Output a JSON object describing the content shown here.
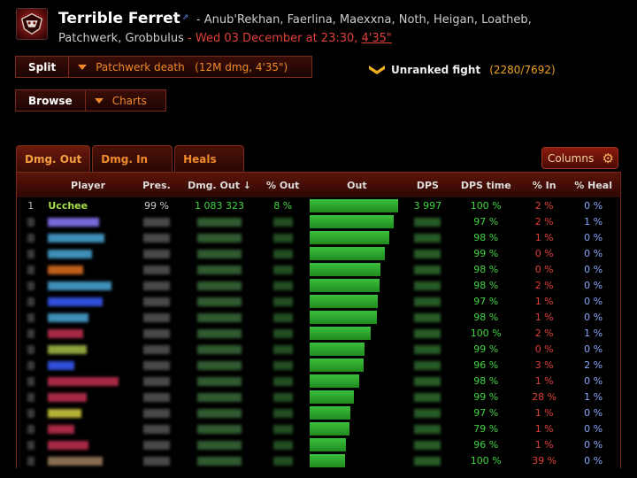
{
  "header": {
    "guild_name": "Terrible Ferret",
    "separator": " - ",
    "bosses_line1": "Anub'Rekhan, Faerlina, Maexxna, Noth, Heigan, Loatheb,",
    "bosses_line2": "Patchwerk, Grobbulus",
    "date": "Wed 03 December at 23:30,",
    "duration": "4'35\""
  },
  "toolbar": {
    "split_label": "Split",
    "split_dropdown": "Patchwerk death   (12M dmg, 4'35\")",
    "browse_label": "Browse",
    "charts_label": "Charts"
  },
  "ranking": {
    "label": "Unranked fight",
    "count": "(2280/7692)"
  },
  "tabs": [
    "Dmg. Out",
    "Dmg. In",
    "Heals"
  ],
  "columns_label": "Columns",
  "table": {
    "headers": [
      "Player",
      "Pres.",
      "Dmg. Out ↓",
      "% Out",
      "Out",
      "DPS",
      "DPS time",
      "% In",
      "% Heal"
    ],
    "rows": [
      {
        "idx": "1",
        "name": "Ucchee",
        "pres": "99 %",
        "dmg": "1 083 323",
        "pout": "8 %",
        "out": 1.0,
        "dps": "3 997",
        "time": "100 %",
        "pin": "2 %",
        "pheal": "0 %"
      },
      {
        "idx": "",
        "name": "",
        "pres": "",
        "dmg": "",
        "pout": "",
        "out": 0.95,
        "dps": "",
        "time": "97 %",
        "pin": "2 %",
        "pheal": "1 %"
      },
      {
        "idx": "",
        "name": "",
        "pres": "",
        "dmg": "",
        "pout": "",
        "out": 0.9,
        "dps": "",
        "time": "98 %",
        "pin": "1 %",
        "pheal": "0 %"
      },
      {
        "idx": "",
        "name": "",
        "pres": "",
        "dmg": "",
        "pout": "",
        "out": 0.85,
        "dps": "",
        "time": "99 %",
        "pin": "0 %",
        "pheal": "0 %"
      },
      {
        "idx": "",
        "name": "",
        "pres": "",
        "dmg": "",
        "pout": "",
        "out": 0.8,
        "dps": "",
        "time": "98 %",
        "pin": "0 %",
        "pheal": "0 %"
      },
      {
        "idx": "",
        "name": "",
        "pres": "",
        "dmg": "",
        "pout": "",
        "out": 0.79,
        "dps": "",
        "time": "98 %",
        "pin": "2 %",
        "pheal": "0 %"
      },
      {
        "idx": "",
        "name": "",
        "pres": "",
        "dmg": "",
        "pout": "",
        "out": 0.77,
        "dps": "",
        "time": "97 %",
        "pin": "1 %",
        "pheal": "0 %"
      },
      {
        "idx": "",
        "name": "",
        "pres": "",
        "dmg": "",
        "pout": "",
        "out": 0.76,
        "dps": "",
        "time": "98 %",
        "pin": "1 %",
        "pheal": "0 %"
      },
      {
        "idx": "",
        "name": "",
        "pres": "",
        "dmg": "",
        "pout": "",
        "out": 0.69,
        "dps": "",
        "time": "100 %",
        "pin": "2 %",
        "pheal": "1 %"
      },
      {
        "idx": "",
        "name": "",
        "pres": "",
        "dmg": "",
        "pout": "",
        "out": 0.62,
        "dps": "",
        "time": "99 %",
        "pin": "0 %",
        "pheal": "0 %"
      },
      {
        "idx": "",
        "name": "",
        "pres": "",
        "dmg": "",
        "pout": "",
        "out": 0.61,
        "dps": "",
        "time": "96 %",
        "pin": "3 %",
        "pheal": "2 %"
      },
      {
        "idx": "",
        "name": "",
        "pres": "",
        "dmg": "",
        "pout": "",
        "out": 0.56,
        "dps": "",
        "time": "98 %",
        "pin": "1 %",
        "pheal": "0 %"
      },
      {
        "idx": "",
        "name": "",
        "pres": "",
        "dmg": "",
        "pout": "",
        "out": 0.5,
        "dps": "",
        "time": "99 %",
        "pin": "28 %",
        "pheal": "1 %"
      },
      {
        "idx": "",
        "name": "",
        "pres": "",
        "dmg": "",
        "pout": "",
        "out": 0.46,
        "dps": "",
        "time": "97 %",
        "pin": "1 %",
        "pheal": "0 %"
      },
      {
        "idx": "",
        "name": "",
        "pres": "",
        "dmg": "",
        "pout": "",
        "out": 0.45,
        "dps": "",
        "time": "79 %",
        "pin": "1 %",
        "pheal": "0 %"
      },
      {
        "idx": "",
        "name": "",
        "pres": "",
        "dmg": "",
        "pout": "",
        "out": 0.41,
        "dps": "",
        "time": "96 %",
        "pin": "1 %",
        "pheal": "0 %"
      },
      {
        "idx": "",
        "name": "",
        "pres": "",
        "dmg": "",
        "pout": "",
        "out": 0.4,
        "dps": "",
        "time": "100 %",
        "pin": "39 %",
        "pheal": "0 %"
      }
    ],
    "name_colors": [
      "#a6e04a",
      "#8c7cff",
      "#4aa8d8",
      "#4aa8d8",
      "#e07020",
      "#4aa8d8",
      "#3a5cff",
      "#4aa8d8",
      "#c43050",
      "#a6c04a",
      "#3a5cff",
      "#c43050",
      "#c43050",
      "#d8d040",
      "#c43050",
      "#c43050",
      "#a08060"
    ]
  }
}
